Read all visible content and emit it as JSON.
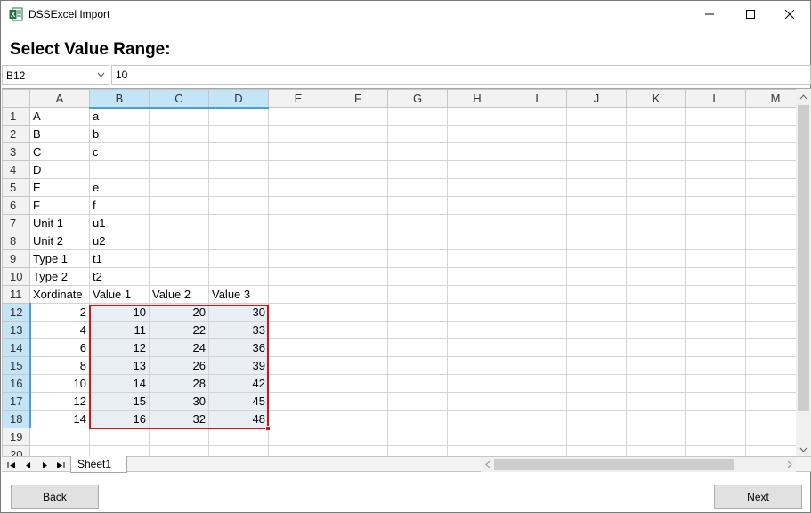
{
  "window": {
    "title": "DSSExcel Import"
  },
  "heading": "Select Value Range:",
  "namebox": {
    "value": "B12"
  },
  "formula": {
    "value": "10"
  },
  "columns": [
    "A",
    "B",
    "C",
    "D",
    "E",
    "F",
    "G",
    "H",
    "I",
    "J",
    "K",
    "L",
    "M"
  ],
  "selected_columns": [
    "B",
    "C",
    "D"
  ],
  "selected_rows": [
    12,
    13,
    14,
    15,
    16,
    17,
    18
  ],
  "rows": [
    {
      "n": "1",
      "cells": [
        "A",
        "a",
        "",
        "",
        ""
      ]
    },
    {
      "n": "2",
      "cells": [
        "B",
        "b",
        "",
        "",
        ""
      ]
    },
    {
      "n": "3",
      "cells": [
        "C",
        "c",
        "",
        "",
        ""
      ]
    },
    {
      "n": "4",
      "cells": [
        "D",
        "",
        "",
        "",
        ""
      ]
    },
    {
      "n": "5",
      "cells": [
        "E",
        "e",
        "",
        "",
        ""
      ]
    },
    {
      "n": "6",
      "cells": [
        "F",
        "f",
        "",
        "",
        ""
      ]
    },
    {
      "n": "7",
      "cells": [
        "Unit 1",
        "u1",
        "",
        "",
        ""
      ]
    },
    {
      "n": "8",
      "cells": [
        "Unit 2",
        "u2",
        "",
        "",
        ""
      ]
    },
    {
      "n": "9",
      "cells": [
        "Type 1",
        "t1",
        "",
        "",
        ""
      ]
    },
    {
      "n": "10",
      "cells": [
        "Type 2",
        "t2",
        "",
        "",
        ""
      ]
    },
    {
      "n": "11",
      "cells": [
        "Xordinate",
        "Value 1",
        "Value 2",
        "Value 3",
        ""
      ]
    },
    {
      "n": "12",
      "cells": [
        "2",
        "10",
        "20",
        "30",
        ""
      ],
      "numeric": true
    },
    {
      "n": "13",
      "cells": [
        "4",
        "11",
        "22",
        "33",
        ""
      ],
      "numeric": true
    },
    {
      "n": "14",
      "cells": [
        "6",
        "12",
        "24",
        "36",
        ""
      ],
      "numeric": true
    },
    {
      "n": "15",
      "cells": [
        "8",
        "13",
        "26",
        "39",
        ""
      ],
      "numeric": true
    },
    {
      "n": "16",
      "cells": [
        "10",
        "14",
        "28",
        "42",
        ""
      ],
      "numeric": true
    },
    {
      "n": "17",
      "cells": [
        "12",
        "15",
        "30",
        "45",
        ""
      ],
      "numeric": true
    },
    {
      "n": "18",
      "cells": [
        "14",
        "16",
        "32",
        "48",
        ""
      ],
      "numeric": true
    },
    {
      "n": "19",
      "cells": [
        "",
        "",
        "",
        "",
        ""
      ]
    },
    {
      "n": "20",
      "cells": [
        "",
        "",
        "",
        "",
        ""
      ]
    }
  ],
  "sheet_tabs": [
    "Sheet1"
  ],
  "buttons": {
    "back": "Back",
    "next": "Next"
  },
  "colors": {
    "selection_border": "#e01010",
    "header_selected": "#c3e5f7",
    "selected_cell_fill": "#e9eff5"
  }
}
